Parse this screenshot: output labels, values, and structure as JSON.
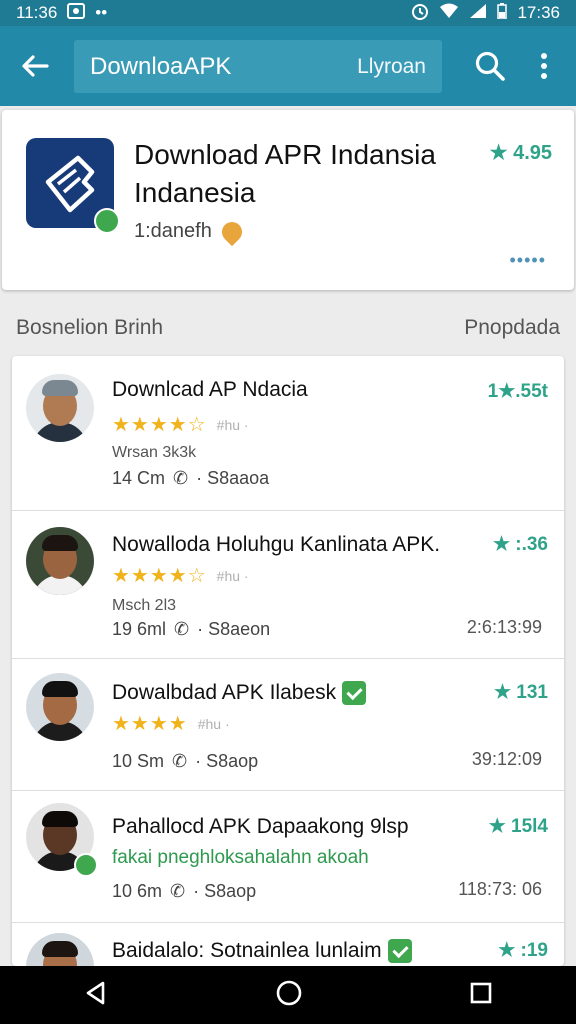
{
  "status": {
    "time_left": "11:36",
    "time_right": "17:36"
  },
  "appbar": {
    "search_query": "DownloaAPK",
    "search_hint": "Llyroan",
    "back_icon": "arrow-left-icon",
    "search_icon": "search-icon",
    "menu_icon": "more-vertical-icon"
  },
  "header": {
    "title": "Download APR Indansia Indanesia",
    "subtitle": "1:danefh",
    "rating": "★ 4.95",
    "more": "•••••"
  },
  "section": {
    "left": "Bosnelion Brinh",
    "right": "Pnopdada"
  },
  "items": [
    {
      "title": "Downlcad AP Ndacia",
      "rating": "1★.55t",
      "stars": "★★★★☆",
      "stars_meta": "#hu ·",
      "sub": "Wrsan 3k3k",
      "meta_left": "14 Cm",
      "meta_right": "· S8aaoa",
      "time": ""
    },
    {
      "title": "Nowalloda Holuhgu Kanlinata APK.",
      "rating": "★ :.36",
      "stars": "★★★★☆",
      "stars_meta": "#hu ·",
      "sub": "Msch 2l3",
      "meta_left": "19 6ml",
      "meta_right": "· S8aeon",
      "time": "2:6:13:99"
    },
    {
      "title": "Dowalbdad APK Ilabesk",
      "rating": "★ 131",
      "stars": "★★★★",
      "stars_meta": "#hu ·",
      "sub": "",
      "meta_left": "10 Sm",
      "meta_right": "· S8aop",
      "time": "39:12:09"
    },
    {
      "title": "Pahallocd APK Dapaakong 9lsp",
      "rating": "★ 15l4",
      "stars": "",
      "stars_meta": "",
      "sub": "fakai pneghloksahalahn akoah",
      "meta_left": "10 6m",
      "meta_right": "· S8aop",
      "time": "118:73: 06"
    },
    {
      "title": "Baidalalo: Sotnainlea lunlaim",
      "rating": "★ :19",
      "stars": "",
      "stars_meta": "",
      "sub": "",
      "meta_left": "",
      "meta_right": "",
      "time": ""
    }
  ]
}
